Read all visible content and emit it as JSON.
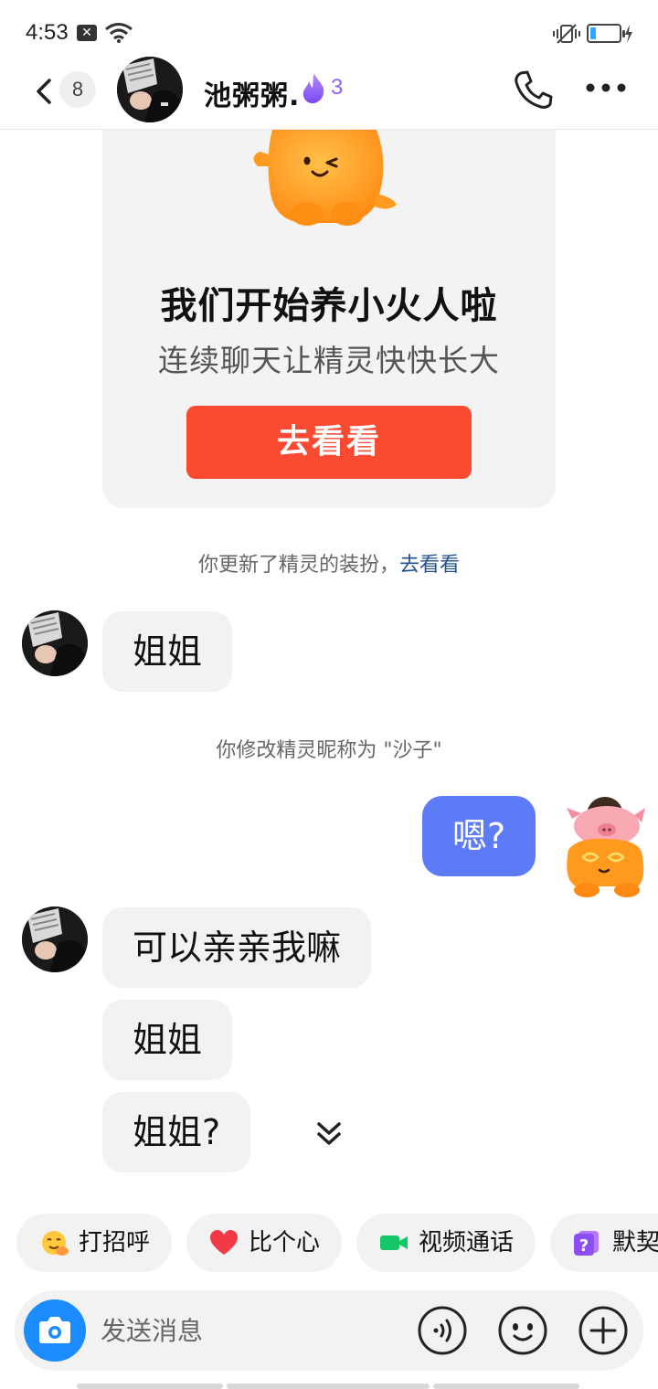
{
  "status_bar": {
    "time": "4:53",
    "notification_icon": "close-box-icon",
    "wifi_icon": "wifi-icon",
    "vibrate_icon": "vibrate-icon",
    "battery_icon": "battery-icon",
    "battery_fraction": 0.2,
    "charging_icon": "charging-bolt-icon"
  },
  "header": {
    "unread_count": "8",
    "contact_name": "池粥粥.",
    "streak_icon": "flame-icon",
    "streak_count": "3",
    "call_icon": "phone-icon",
    "more_icon": "more-dots-icon"
  },
  "spirit_card": {
    "title": "我们开始养小火人啦",
    "subtitle": "连续聊天让精灵快快长大",
    "button_label": "去看看"
  },
  "notices": {
    "outfit_text": "你更新了精灵的装扮，",
    "outfit_link": "去看看",
    "nickname_text": "你修改精灵昵称为 \"沙子\""
  },
  "messages": [
    {
      "sender": "them",
      "text": "姐姐"
    },
    {
      "sender": "me",
      "text": "嗯?"
    },
    {
      "sender": "them",
      "text": "可以亲亲我嘛"
    },
    {
      "sender": "them",
      "text": "姐姐"
    },
    {
      "sender": "them",
      "text": "姐姐?"
    }
  ],
  "quick_replies": [
    {
      "icon": "hug-emoji-icon",
      "label": "打招呼"
    },
    {
      "icon": "heart-icon",
      "label": "比个心"
    },
    {
      "icon": "video-camera-icon",
      "label": "视频通话"
    },
    {
      "icon": "question-card-icon",
      "label": "默契"
    }
  ],
  "input_bar": {
    "placeholder": "发送消息",
    "camera_icon": "camera-icon",
    "voice_icon": "voice-icon",
    "emoji_icon": "emoji-icon",
    "plus_icon": "plus-icon"
  },
  "colors": {
    "accent_blue": "#5e7bf7",
    "button_red": "#fa4a32",
    "flame_purple": "#8e63f5",
    "link_blue": "#21508f",
    "camera_blue": "#1a8cff"
  }
}
